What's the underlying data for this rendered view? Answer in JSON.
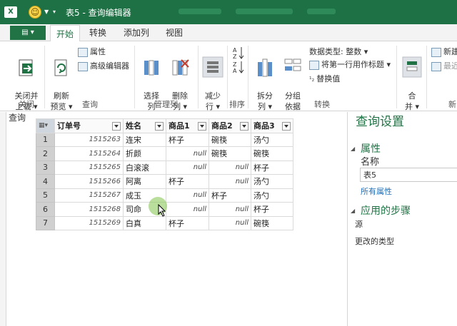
{
  "title_bar": {
    "app_icon": "excel-icon",
    "title": "表5 - 查询编辑器"
  },
  "tabs": {
    "file_label": "▤ ▾",
    "items": [
      "开始",
      "转换",
      "添加列",
      "视图"
    ],
    "active_index": 0
  },
  "ribbon": {
    "close": {
      "btn": "关闭并\n上载 ▾",
      "group": "关闭"
    },
    "query": {
      "refresh": "刷新\n预览 ▾",
      "props": "属性",
      "adv": "高级编辑器",
      "group": "查询"
    },
    "manage": {
      "select_cols": "选择\n列",
      "remove_cols": "删除\n列 ▾",
      "group": "管理列"
    },
    "reduce": {
      "label": "减少\n行 ▾"
    },
    "sort": {
      "group": "排序"
    },
    "transform": {
      "split": "拆分\n列 ▾",
      "group_by": "分组\n依据",
      "data_type": "数据类型: 整数 ▾",
      "first_row": "将第一行用作标题 ▾",
      "replace": "替换值",
      "group": "转换"
    },
    "combine": {
      "merge": "合\n并 ▾",
      "new": "新建",
      "recent": "最近"
    },
    "new_group_partial": "新"
  },
  "left_label": "查询",
  "grid": {
    "columns": [
      "订单号",
      "姓名",
      "商品1",
      "商品2",
      "商品3"
    ],
    "rows": [
      [
        "1",
        "1515263",
        "连宋",
        "杯子",
        "碗筷",
        "汤勺"
      ],
      [
        "2",
        "1515264",
        "折颜",
        "null",
        "碗筷",
        "碗筷"
      ],
      [
        "3",
        "1515265",
        "白滚滚",
        "null",
        "null",
        "杯子"
      ],
      [
        "4",
        "1515266",
        "阿离",
        "杯子",
        "null",
        "汤勺"
      ],
      [
        "5",
        "1515267",
        "成玉",
        "null",
        "杯子",
        "汤勺"
      ],
      [
        "6",
        "1515268",
        "司命",
        "null",
        "null",
        "杯子"
      ],
      [
        "7",
        "1515269",
        "白真",
        "杯子",
        "null",
        "碗筷"
      ]
    ]
  },
  "settings": {
    "title": "查询设置",
    "props_heading": "属性",
    "name_label": "名称",
    "name_value": "表5",
    "all_props_link": "所有属性",
    "steps_heading": "应用的步骤",
    "steps": [
      "源",
      "更改的类型"
    ]
  }
}
